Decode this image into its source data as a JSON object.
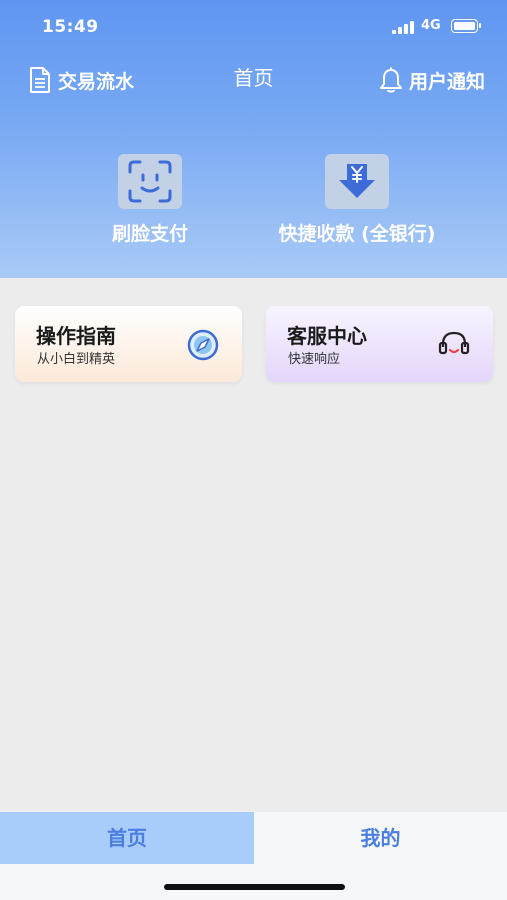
{
  "status_bar": {
    "time": "15:49",
    "network": "4G"
  },
  "nav": {
    "left_label": "交易流水",
    "left_icon": "document-icon",
    "title": "首页",
    "right_label": "用户通知",
    "right_icon": "bell-icon"
  },
  "quick_actions": [
    {
      "label": "刷脸支付",
      "icon": "face-scan-icon"
    },
    {
      "label": "快捷收款 (全银行)",
      "icon": "yen-download-icon"
    }
  ],
  "cards": [
    {
      "title": "操作指南",
      "subtitle": "从小白到精英",
      "icon": "compass-icon"
    },
    {
      "title": "客服中心",
      "subtitle": "快速响应",
      "icon": "headset-icon"
    }
  ],
  "tabs": [
    {
      "label": "首页",
      "active": true
    },
    {
      "label": "我的",
      "active": false
    }
  ],
  "colors": {
    "header_top": "#5f96f2",
    "tab_active_bg": "#a9cdfb",
    "tab_text": "#4a7fe0"
  }
}
